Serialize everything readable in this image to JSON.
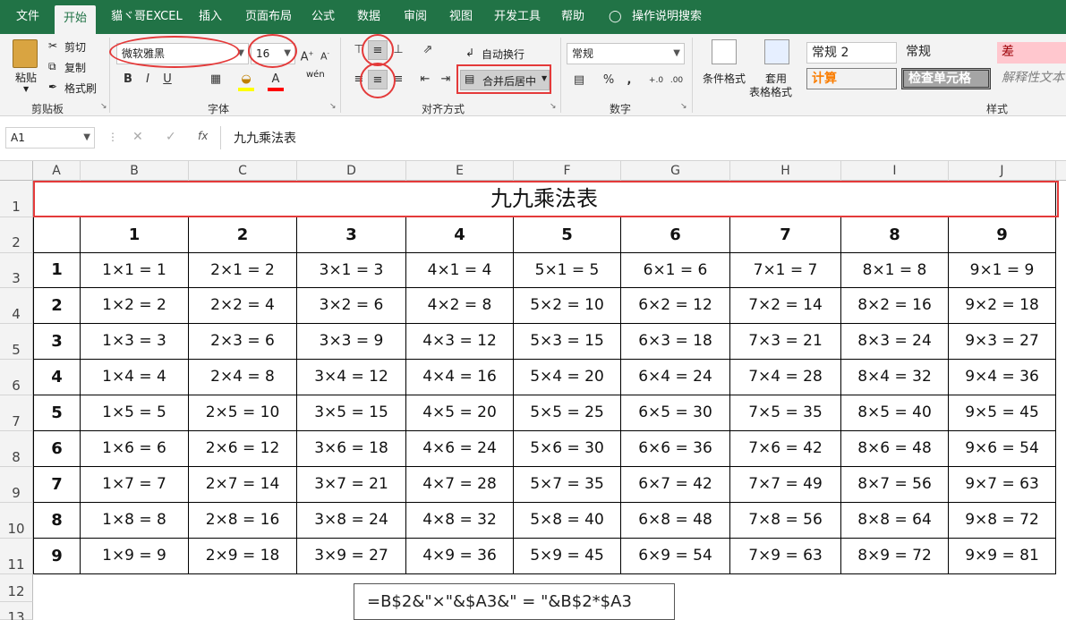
{
  "menu": {
    "items": [
      "文件",
      "开始",
      "貓ヾ哥EXCEL",
      "插入",
      "页面布局",
      "公式",
      "数据",
      "审阅",
      "视图",
      "开发工具",
      "帮助"
    ],
    "search_label": "操作说明搜索"
  },
  "ribbon": {
    "clipboard": {
      "paste": "粘贴",
      "cut": "剪切",
      "copy": "复制",
      "format_painter": "格式刷",
      "group": "剪贴板"
    },
    "font": {
      "name": "微软雅黑",
      "size": "16",
      "bold": "B",
      "italic": "I",
      "underline": "U",
      "wen": "wén",
      "group": "字体"
    },
    "align": {
      "wrap": "自动换行",
      "merge": "合并后居中",
      "group": "对齐方式"
    },
    "number": {
      "format": "常规",
      "percent": "%",
      "comma": ",",
      "group": "数字"
    },
    "styles": {
      "conditional": "条件格式",
      "table_format_1": "套用",
      "table_format_2": "表格格式",
      "normal2": "常规 2",
      "normal": "常规",
      "bad": "差",
      "calc": "计算",
      "check": "检查单元格",
      "explain": "解释性文本",
      "group": "样式"
    }
  },
  "formula_bar": {
    "name_box": "A1",
    "fx": "fx",
    "content": "九九乘法表"
  },
  "columns": [
    "A",
    "B",
    "C",
    "D",
    "E",
    "F",
    "G",
    "H",
    "I",
    "J"
  ],
  "rows": [
    "1",
    "2",
    "3",
    "4",
    "5",
    "6",
    "7",
    "8",
    "9",
    "10",
    "11",
    "12",
    "13"
  ],
  "sheet": {
    "title": "九九乘法表",
    "header_numbers": [
      "1",
      "2",
      "3",
      "4",
      "5",
      "6",
      "7",
      "8",
      "9"
    ],
    "row_numbers": [
      "1",
      "2",
      "3",
      "4",
      "5",
      "6",
      "7",
      "8",
      "9"
    ],
    "table": [
      [
        "1×1 = 1",
        "2×1 = 2",
        "3×1 = 3",
        "4×1 = 4",
        "5×1 = 5",
        "6×1 = 6",
        "7×1 = 7",
        "8×1 = 8",
        "9×1 = 9"
      ],
      [
        "1×2 = 2",
        "2×2 = 4",
        "3×2 = 6",
        "4×2 = 8",
        "5×2 = 10",
        "6×2 = 12",
        "7×2 = 14",
        "8×2 = 16",
        "9×2 = 18"
      ],
      [
        "1×3 = 3",
        "2×3 = 6",
        "3×3 = 9",
        "4×3 = 12",
        "5×3 = 15",
        "6×3 = 18",
        "7×3 = 21",
        "8×3 = 24",
        "9×3 = 27"
      ],
      [
        "1×4 = 4",
        "2×4 = 8",
        "3×4 = 12",
        "4×4 = 16",
        "5×4 = 20",
        "6×4 = 24",
        "7×4 = 28",
        "8×4 = 32",
        "9×4 = 36"
      ],
      [
        "1×5 = 5",
        "2×5 = 10",
        "3×5 = 15",
        "4×5 = 20",
        "5×5 = 25",
        "6×5 = 30",
        "7×5 = 35",
        "8×5 = 40",
        "9×5 = 45"
      ],
      [
        "1×6 = 6",
        "2×6 = 12",
        "3×6 = 18",
        "4×6 = 24",
        "5×6 = 30",
        "6×6 = 36",
        "7×6 = 42",
        "8×6 = 48",
        "9×6 = 54"
      ],
      [
        "1×7 = 7",
        "2×7 = 14",
        "3×7 = 21",
        "4×7 = 28",
        "5×7 = 35",
        "6×7 = 42",
        "7×7 = 49",
        "8×7 = 56",
        "9×7 = 63"
      ],
      [
        "1×8 = 8",
        "2×8 = 16",
        "3×8 = 24",
        "4×8 = 32",
        "5×8 = 40",
        "6×8 = 48",
        "7×8 = 56",
        "8×8 = 64",
        "9×8 = 72"
      ],
      [
        "1×9 = 9",
        "2×9 = 18",
        "3×9 = 27",
        "4×9 = 36",
        "5×9 = 45",
        "6×9 = 54",
        "7×9 = 63",
        "8×9 = 72",
        "9×9 = 81"
      ]
    ],
    "formula_note": "=B$2&\"×\"&$A3&\" = \"&B$2*$A3"
  },
  "colors": {
    "excel_green": "#217346",
    "highlight_red": "#e43a3a",
    "bad_fill": "#ffc7ce",
    "calc_text": "#fa7d00"
  }
}
